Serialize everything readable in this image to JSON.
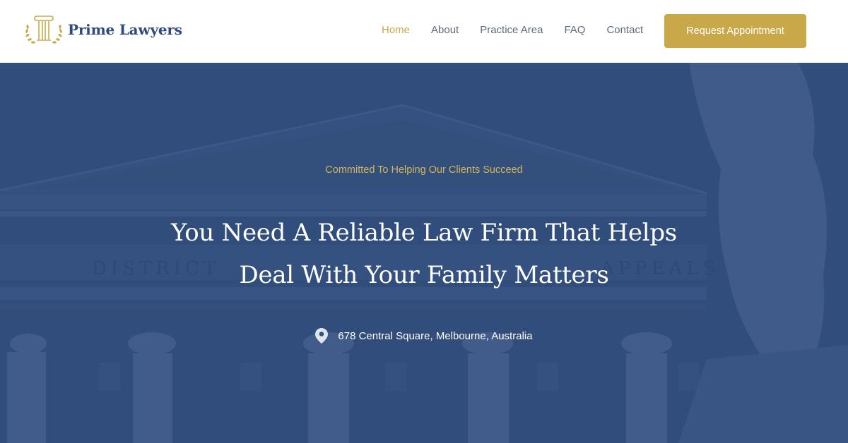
{
  "brand": {
    "name": "Prime Lawyers",
    "logo_icon": "pillar-laurel-logo-icon"
  },
  "nav": {
    "items": [
      {
        "label": "Home",
        "active": true
      },
      {
        "label": "About",
        "active": false
      },
      {
        "label": "Practice Area",
        "active": false
      },
      {
        "label": "FAQ",
        "active": false
      },
      {
        "label": "Contact",
        "active": false
      }
    ],
    "cta_label": "Request Appointment"
  },
  "hero": {
    "eyebrow": "Committed To Helping Our Clients Succeed",
    "title_line1": "You Need A Reliable Law Firm That Helps",
    "title_line2": "Deal With Your Family Matters",
    "address": "678 Central Square, Melbourne, Australia",
    "address_icon": "map-pin-icon",
    "background_inscription_left": "DISTRICT",
    "background_inscription_right": "APPEALS"
  },
  "colors": {
    "accent_gold": "#c9a84a",
    "brand_navy": "#2e4a7d",
    "hero_blue": "#34507f",
    "nav_text": "#5f6b7b"
  }
}
